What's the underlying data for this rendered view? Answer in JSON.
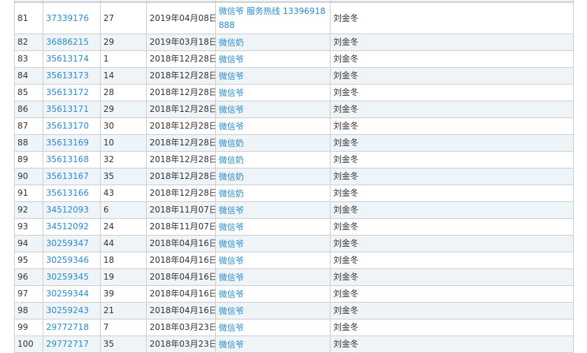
{
  "rows": [
    {
      "idx": "81",
      "id": "37339176",
      "num": "27",
      "date": "2019年04月08日",
      "name": "微信爷 服务热线 13396918888",
      "person": "刘金冬"
    },
    {
      "idx": "82",
      "id": "36886215",
      "num": "29",
      "date": "2019年03月18日",
      "name": "微信奶",
      "person": "刘金冬"
    },
    {
      "idx": "83",
      "id": "35613174",
      "num": "1",
      "date": "2018年12月28日",
      "name": "微信爷",
      "person": "刘金冬"
    },
    {
      "idx": "84",
      "id": "35613173",
      "num": "14",
      "date": "2018年12月28日",
      "name": "微信爷",
      "person": "刘金冬"
    },
    {
      "idx": "85",
      "id": "35613172",
      "num": "28",
      "date": "2018年12月28日",
      "name": "微信爷",
      "person": "刘金冬"
    },
    {
      "idx": "86",
      "id": "35613171",
      "num": "29",
      "date": "2018年12月28日",
      "name": "微信爷",
      "person": "刘金冬"
    },
    {
      "idx": "87",
      "id": "35613170",
      "num": "30",
      "date": "2018年12月28日",
      "name": "微信爷",
      "person": "刘金冬"
    },
    {
      "idx": "88",
      "id": "35613169",
      "num": "10",
      "date": "2018年12月28日",
      "name": "微信奶",
      "person": "刘金冬"
    },
    {
      "idx": "89",
      "id": "35613168",
      "num": "32",
      "date": "2018年12月28日",
      "name": "微信奶",
      "person": "刘金冬"
    },
    {
      "idx": "90",
      "id": "35613167",
      "num": "35",
      "date": "2018年12月28日",
      "name": "微信奶",
      "person": "刘金冬"
    },
    {
      "idx": "91",
      "id": "35613166",
      "num": "43",
      "date": "2018年12月28日",
      "name": "微信奶",
      "person": "刘金冬"
    },
    {
      "idx": "92",
      "id": "34512093",
      "num": "6",
      "date": "2018年11月07日",
      "name": "微信爷",
      "person": "刘金冬"
    },
    {
      "idx": "93",
      "id": "34512092",
      "num": "24",
      "date": "2018年11月07日",
      "name": "微信爷",
      "person": "刘金冬"
    },
    {
      "idx": "94",
      "id": "30259347",
      "num": "44",
      "date": "2018年04月16日",
      "name": "微信爷",
      "person": "刘金冬"
    },
    {
      "idx": "95",
      "id": "30259346",
      "num": "18",
      "date": "2018年04月16日",
      "name": "微信爷",
      "person": "刘金冬"
    },
    {
      "idx": "96",
      "id": "30259345",
      "num": "19",
      "date": "2018年04月16日",
      "name": "微信爷",
      "person": "刘金冬"
    },
    {
      "idx": "97",
      "id": "30259344",
      "num": "39",
      "date": "2018年04月16日",
      "name": "微信爷",
      "person": "刘金冬"
    },
    {
      "idx": "98",
      "id": "30259243",
      "num": "21",
      "date": "2018年04月16日",
      "name": "微信爷",
      "person": "刘金冬"
    },
    {
      "idx": "99",
      "id": "29772718",
      "num": "7",
      "date": "2018年03月23日",
      "name": "微信爷",
      "person": "刘金冬"
    },
    {
      "idx": "100",
      "id": "29772717",
      "num": "35",
      "date": "2018年03月23日",
      "name": "微信爷",
      "person": "刘金冬"
    }
  ]
}
